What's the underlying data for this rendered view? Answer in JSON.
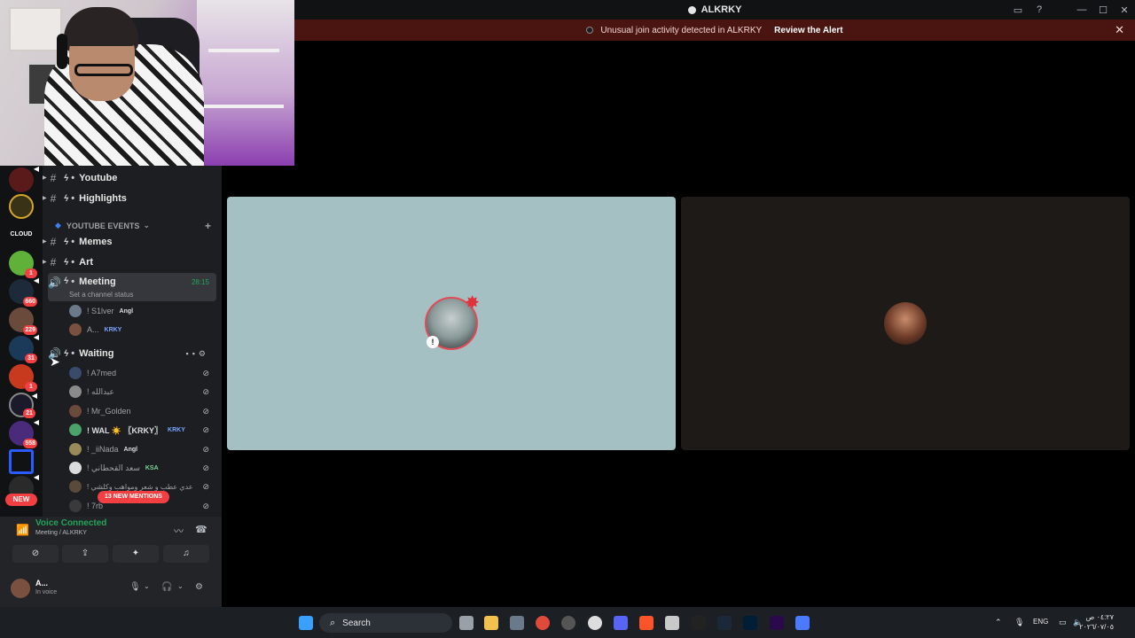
{
  "app": {
    "title": "ALKRKY"
  },
  "alert": {
    "message": "Unusual join activity detected in ALKRKY",
    "action": "Review the Alert",
    "close": "✕"
  },
  "channels": {
    "youtube": "Youtube",
    "highlights": "Highlights",
    "category_events": "YOUTUBE EVENTS",
    "memes": "Memes",
    "art": "Art",
    "meeting": "Meeting",
    "meeting_timer": "28:15",
    "meeting_status": "Set a channel status",
    "waiting": "Waiting"
  },
  "meeting_users": [
    {
      "name": "! S1lver",
      "tag": "Angl"
    },
    {
      "name": "A...",
      "tag": "KRKY"
    }
  ],
  "waiting_users": [
    {
      "name": "! A7med",
      "tag": ""
    },
    {
      "name": "! عبدالله",
      "tag": ""
    },
    {
      "name": "! Mr_Golden",
      "tag": ""
    },
    {
      "name": "! WAL ☀️ 〖KRKY〗",
      "tag": "KRKY"
    },
    {
      "name": "! _iiNada",
      "tag": "Angl"
    },
    {
      "name": "! سعد القحطاني",
      "tag": "KSA"
    },
    {
      "name": "! عدي عطب و شعر ومواهب وكلشي",
      "tag": ""
    },
    {
      "name": "! 7rb",
      "tag": ""
    }
  ],
  "mentions": "13 NEW MENTIONS",
  "rail": {
    "badges": [
      "1",
      "660",
      "229",
      "31",
      "1",
      "21",
      "558"
    ],
    "new_label": "NEW"
  },
  "voice": {
    "title": "Voice Connected",
    "location": "Meeting / ALKRKY"
  },
  "me": {
    "name": "A...",
    "status": "In voice"
  },
  "taskbar": {
    "search": "Search",
    "lang": "ENG",
    "time": "٠٤:٢٧ ص",
    "date": "٢٠٢٦/٠٧/٠٥"
  },
  "colors": {
    "accent_green": "#23a55a",
    "alert_bg": "#4a1511",
    "danger": "#f23f42",
    "tile_a": "#a5c0c2",
    "tile_b": "#1e1a17"
  }
}
